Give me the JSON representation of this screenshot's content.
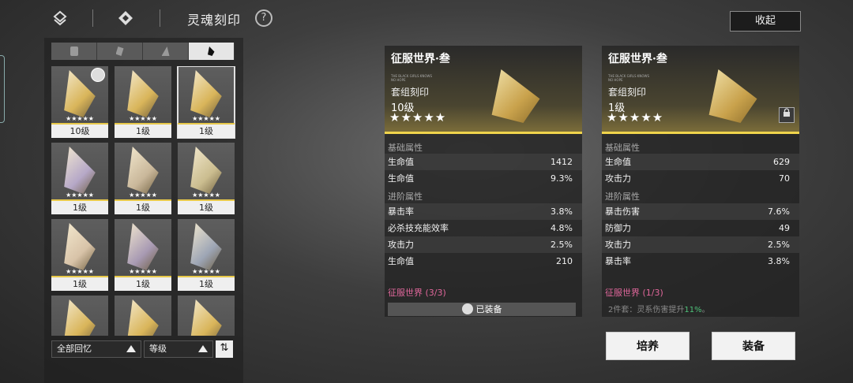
{
  "topbar": {
    "title": "灵魂刻印",
    "help": "?",
    "collapse": "收起"
  },
  "filters": [
    "all-shape",
    "shape-1",
    "shape-2",
    "shape-3"
  ],
  "grid": [
    {
      "level": "10级",
      "stars": "★★★★★",
      "color": "#d9b55a",
      "avatar": true,
      "selected": false
    },
    {
      "level": "1级",
      "stars": "★★★★★",
      "color": "#d9b55a",
      "avatar": false,
      "selected": false
    },
    {
      "level": "1级",
      "stars": "★★★★★",
      "color": "#d9b55a",
      "avatar": false,
      "selected": true
    },
    {
      "level": "1级",
      "stars": "★★★★★",
      "color": "#b6a8c8",
      "avatar": false,
      "selected": false
    },
    {
      "level": "1级",
      "stars": "★★★★★",
      "color": "#c9b79a",
      "avatar": false,
      "selected": false
    },
    {
      "level": "1级",
      "stars": "★★★★★",
      "color": "#cbbd8f",
      "avatar": false,
      "selected": false
    },
    {
      "level": "1级",
      "stars": "★★★★★",
      "color": "#d8c3a8",
      "avatar": false,
      "selected": false
    },
    {
      "level": "1级",
      "stars": "★★★★★",
      "color": "#a89ab3",
      "avatar": false,
      "selected": false
    },
    {
      "level": "1级",
      "stars": "★★★★★",
      "color": "#9da5b5",
      "avatar": false,
      "selected": false
    },
    {
      "level": "",
      "stars": "",
      "color": "#d9b55a",
      "avatar": false,
      "selected": false
    },
    {
      "level": "",
      "stars": "",
      "color": "#d9b55a",
      "avatar": false,
      "selected": false
    },
    {
      "level": "",
      "stars": "",
      "color": "#d9b55a",
      "avatar": false,
      "selected": false
    }
  ],
  "sort": {
    "filter": "全部回忆",
    "order": "等级",
    "toggle": "⇅"
  },
  "left_card": {
    "name": "征服世界·叁",
    "tiny": "THE BLACK GIRLS KNOWS\nNO HOPE",
    "type": "套组刻印",
    "level": "10级",
    "stars": "★★★★★",
    "base_label": "基础属性",
    "base": [
      {
        "k": "生命值",
        "v": "1412"
      },
      {
        "k": "生命值",
        "v": "9.3%"
      }
    ],
    "adv_label": "进阶属性",
    "adv": [
      {
        "k": "暴击率",
        "v": "3.8%"
      },
      {
        "k": "必杀技充能效率",
        "v": "4.8%"
      },
      {
        "k": "攻击力",
        "v": "2.5%"
      },
      {
        "k": "生命值",
        "v": "210"
      }
    ],
    "set_name": "征服世界 (3/3)",
    "equipped": "已装备"
  },
  "right_card": {
    "name": "征服世界·叁",
    "tiny": "THE BLACK GIRLS KNOWS\nNO HOPE",
    "type": "套组刻印",
    "level": "1级",
    "stars": "★★★★★",
    "lock": "🔒",
    "base_label": "基础属性",
    "base": [
      {
        "k": "生命值",
        "v": "629"
      },
      {
        "k": "攻击力",
        "v": "70"
      }
    ],
    "adv_label": "进阶属性",
    "adv": [
      {
        "k": "暴击伤害",
        "v": "7.6%"
      },
      {
        "k": "防御力",
        "v": "49"
      },
      {
        "k": "攻击力",
        "v": "2.5%"
      },
      {
        "k": "暴击率",
        "v": "3.8%"
      }
    ],
    "set_name": "征服世界 (1/3)",
    "set_desc_prefix": "2件套：灵系伤害提升",
    "set_desc_value": "11%",
    "set_desc_suffix": "。"
  },
  "buttons": {
    "cultivate": "培养",
    "equip": "装备"
  }
}
